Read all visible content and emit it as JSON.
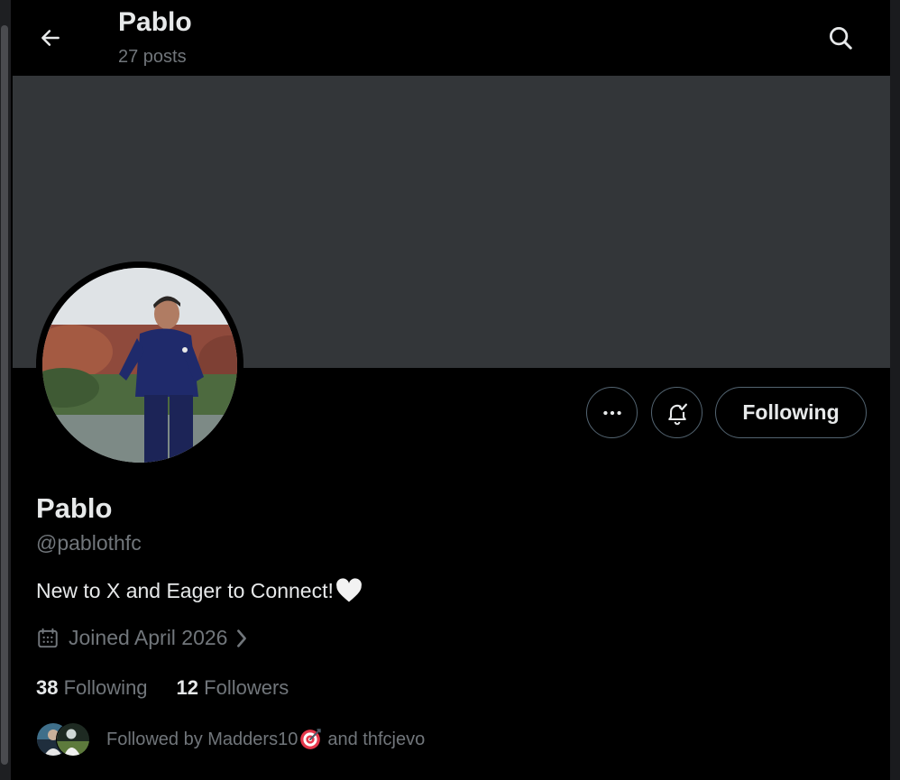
{
  "header": {
    "title": "Pablo",
    "posts_count": "27 posts"
  },
  "profile": {
    "name": "Pablo",
    "handle": "@pablothfc",
    "bio": "New to X and Eager to Connect!",
    "bio_emoji": "white-heart",
    "joined": "Joined April 2026",
    "following_count": "38",
    "following_label": "Following",
    "followers_count": "12",
    "followers_label": "Followers",
    "followed_by_prefix": "Followed by Madders10",
    "followed_by_emoji": "direct-hit-target",
    "followed_by_suffix": "and thfcjevo"
  },
  "actions": {
    "follow_button_label": "Following",
    "more_icon": "more-horizontal-icon",
    "notify_icon": "bell-check-icon"
  },
  "colors": {
    "background": "#000000",
    "banner": "#333639",
    "text_primary": "#e7e9ea",
    "text_secondary": "#71767b",
    "button_border": "#536471"
  }
}
